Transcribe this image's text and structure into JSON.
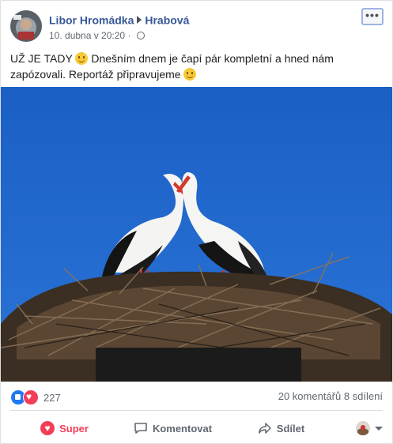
{
  "post": {
    "author": "Libor Hromádka",
    "location": "Hrabová",
    "timestamp": "10. dubna v 20:20",
    "dot": "·",
    "privacy_icon": "globe-icon",
    "more_label": "•••",
    "text_part1": "UŽ JE TADY",
    "text_part2": "Dnešním dnem je čapí pár kompletní a hned nám zapózovali. Reportáž připravujeme",
    "emoji": "smile-emoji"
  },
  "stats": {
    "reactions_count": "227",
    "comments": "20 komentářů",
    "shares": "8 sdílení"
  },
  "actions": {
    "react": "Super",
    "comment": "Komentovat",
    "share": "Sdílet"
  },
  "colors": {
    "link": "#385898",
    "sky": "#1f66c8",
    "love": "#f33e58",
    "like": "#2078f4"
  }
}
